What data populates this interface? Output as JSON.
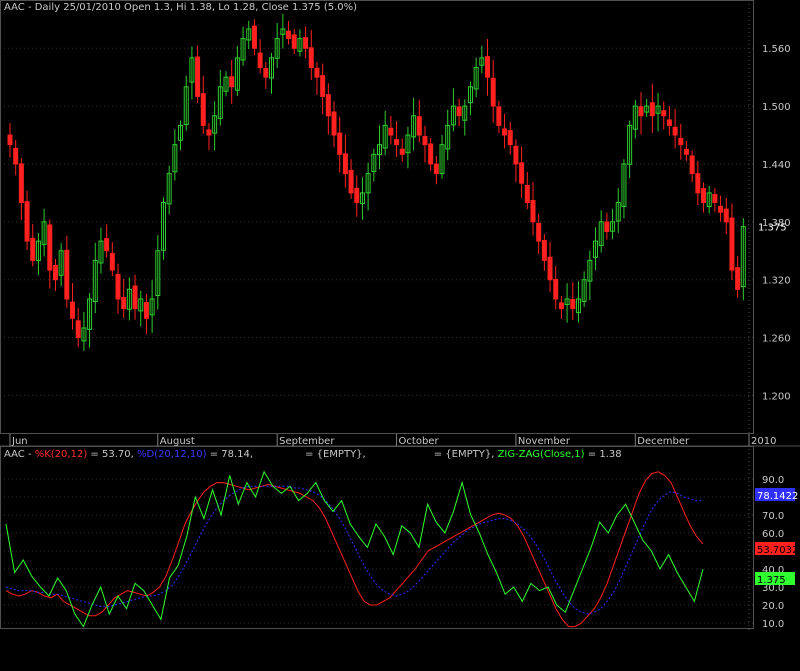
{
  "header": {
    "main": "AAC - Daily 25/01/2010 Open 1.3, Hi 1.38, Lo 1.28, Close 1.375 (5.0%)",
    "ind_prefix": "AAC - ",
    "ind_k": "%K(20,12)",
    "ind_k_val": " = 53.70, ",
    "ind_d": "%D(20,12,10)",
    "ind_d_val": " = 78.14,",
    "empty1": "= {EMPTY},",
    "empty2": "= {EMPTY},",
    "zz": "ZIG-ZAG(Close,1)",
    "zz_val": " = 1.38"
  },
  "colors": {
    "up": "#2ecc2e",
    "down": "#ff2020",
    "k_line": "#ff2020",
    "d_line": "#2f2fff",
    "zigzag": "#30ff30",
    "grid": "#333333",
    "axis_text": "#c8c8c8",
    "bg": "#000000"
  },
  "chart_data": [
    {
      "type": "candlestick",
      "title": "AAC - Daily 25/01/2010 Open 1.3, Hi 1.38, Lo 1.28, Close 1.375 (5.0%)",
      "ylim": [
        1.16,
        1.61
      ],
      "yticks": [
        "1.200",
        "1.260",
        "1.320",
        "1.380",
        "1.440",
        "1.500",
        "1.560"
      ],
      "last_close_label": "1.375",
      "x_labels": [
        "Jun",
        "August",
        "September",
        "October",
        "November",
        "December",
        "2010"
      ],
      "x_label_index": [
        0,
        26,
        47,
        68,
        89,
        110,
        130
      ],
      "closes": [
        1.46,
        1.44,
        1.4,
        1.36,
        1.34,
        1.36,
        1.38,
        1.33,
        1.32,
        1.35,
        1.3,
        1.28,
        1.26,
        1.27,
        1.3,
        1.34,
        1.36,
        1.35,
        1.33,
        1.3,
        1.29,
        1.31,
        1.29,
        1.3,
        1.28,
        1.3,
        1.35,
        1.4,
        1.43,
        1.46,
        1.48,
        1.52,
        1.55,
        1.51,
        1.48,
        1.47,
        1.49,
        1.52,
        1.53,
        1.52,
        1.55,
        1.57,
        1.58,
        1.56,
        1.54,
        1.53,
        1.55,
        1.57,
        1.58,
        1.57,
        1.56,
        1.57,
        1.56,
        1.54,
        1.53,
        1.51,
        1.49,
        1.47,
        1.45,
        1.43,
        1.41,
        1.4,
        1.41,
        1.43,
        1.45,
        1.46,
        1.48,
        1.47,
        1.46,
        1.45,
        1.47,
        1.49,
        1.47,
        1.46,
        1.44,
        1.43,
        1.46,
        1.48,
        1.5,
        1.49,
        1.5,
        1.52,
        1.54,
        1.55,
        1.53,
        1.5,
        1.48,
        1.47,
        1.46,
        1.44,
        1.42,
        1.4,
        1.38,
        1.36,
        1.34,
        1.32,
        1.3,
        1.29,
        1.3,
        1.29,
        1.3,
        1.32,
        1.34,
        1.36,
        1.38,
        1.37,
        1.38,
        1.4,
        1.44,
        1.48,
        1.5,
        1.49,
        1.5,
        1.49,
        1.5,
        1.49,
        1.48,
        1.47,
        1.46,
        1.45,
        1.43,
        1.41,
        1.4,
        1.41,
        1.4,
        1.39,
        1.38,
        1.33,
        1.31,
        1.375
      ],
      "candles_shown": 124
    },
    {
      "type": "line",
      "title": "Stochastic %K / %D with Zig-Zag",
      "ylim": [
        5,
        100
      ],
      "yticks": [
        "10.0",
        "20.0",
        "30.0",
        "40.0",
        "50.0",
        "60.0",
        "70.0",
        "80.0",
        "90.0"
      ],
      "value_labels": [
        {
          "series": "%D(20,12,10)",
          "text": "78.1422"
        },
        {
          "series": "%K(20,12)",
          "text": "53.7032"
        },
        {
          "series": "ZIG-ZAG(Close,1)",
          "text": "1.375"
        }
      ],
      "series": [
        {
          "name": "%K(20,12)",
          "values": [
            28,
            26,
            25,
            26,
            28,
            27,
            25,
            24,
            26,
            22,
            20,
            18,
            16,
            14,
            14,
            16,
            20,
            24,
            26,
            28,
            27,
            26,
            25,
            27,
            30,
            36,
            45,
            55,
            65,
            72,
            78,
            83,
            86,
            88,
            88,
            87,
            86,
            85,
            84,
            85,
            86,
            87,
            86,
            85,
            84,
            83,
            82,
            80,
            78,
            74,
            68,
            60,
            52,
            44,
            36,
            28,
            22,
            20,
            20,
            22,
            24,
            28,
            32,
            36,
            40,
            45,
            50,
            52,
            54,
            56,
            58,
            60,
            62,
            64,
            66,
            68,
            70,
            71,
            70,
            68,
            64,
            58,
            50,
            42,
            34,
            26,
            18,
            12,
            8,
            8,
            10,
            14,
            18,
            24,
            32,
            42,
            52,
            62,
            72,
            82,
            89,
            93,
            94,
            92,
            88,
            80,
            72,
            64,
            58,
            54
          ]
        },
        {
          "name": "%D(20,12,10)",
          "values": [
            30,
            29,
            28,
            28,
            28,
            27,
            27,
            26,
            26,
            25,
            24,
            23,
            22,
            21,
            20,
            19,
            19,
            20,
            21,
            22,
            23,
            24,
            25,
            25,
            26,
            28,
            31,
            36,
            42,
            49,
            56,
            63,
            69,
            74,
            78,
            81,
            83,
            85,
            86,
            86,
            86,
            86,
            86,
            86,
            86,
            85,
            85,
            84,
            83,
            81,
            78,
            74,
            69,
            63,
            56,
            49,
            42,
            36,
            31,
            28,
            26,
            25,
            26,
            28,
            31,
            35,
            39,
            43,
            47,
            51,
            55,
            58,
            61,
            63,
            65,
            66,
            67,
            68,
            68,
            67,
            65,
            62,
            58,
            53,
            47,
            40,
            33,
            27,
            22,
            18,
            16,
            15,
            16,
            18,
            22,
            27,
            34,
            42,
            50,
            58,
            66,
            73,
            78,
            81,
            83,
            82,
            80,
            79,
            78,
            78
          ]
        },
        {
          "name": "ZIG-ZAG(Close,1)",
          "values": [
            65,
            38,
            45,
            36,
            30,
            25,
            35,
            28,
            15,
            8,
            20,
            30,
            15,
            25,
            18,
            32,
            28,
            20,
            12,
            35,
            42,
            58,
            80,
            68,
            84,
            70,
            92,
            76,
            88,
            80,
            94,
            86,
            82,
            86,
            78,
            82,
            88,
            78,
            72,
            78,
            65,
            58,
            52,
            65,
            58,
            48,
            64,
            60,
            52,
            76,
            66,
            60,
            72,
            88,
            70,
            60,
            48,
            38,
            26,
            30,
            22,
            32,
            28,
            30,
            20,
            16,
            28,
            40,
            52,
            66,
            60,
            70,
            76,
            66,
            56,
            50,
            40,
            48,
            38,
            30,
            22,
            40
          ]
        }
      ]
    }
  ]
}
